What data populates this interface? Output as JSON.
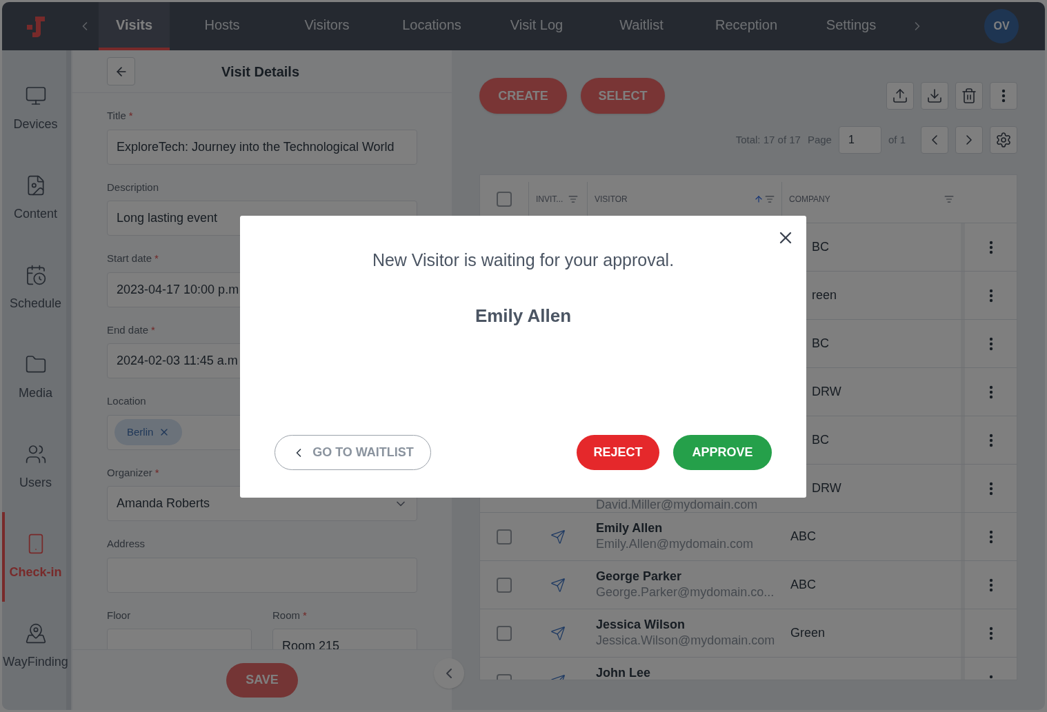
{
  "nav": {
    "items": [
      {
        "label": "Visits",
        "selected": true
      },
      {
        "label": "Hosts",
        "selected": false
      },
      {
        "label": "Visitors",
        "selected": false
      },
      {
        "label": "Locations",
        "selected": false
      },
      {
        "label": "Visit Log",
        "selected": false
      },
      {
        "label": "Waitlist",
        "selected": false
      },
      {
        "label": "Reception",
        "selected": false
      },
      {
        "label": "Settings",
        "selected": false
      }
    ],
    "avatar": "OV"
  },
  "sidebar": {
    "items": [
      {
        "label": "Devices",
        "selected": false,
        "kind": "monitor"
      },
      {
        "label": "Content",
        "selected": false,
        "kind": "content"
      },
      {
        "label": "Schedule",
        "selected": false,
        "kind": "calendar"
      },
      {
        "label": "Media",
        "selected": false,
        "kind": "folder"
      },
      {
        "label": "Users",
        "selected": false,
        "kind": "users"
      },
      {
        "label": "Check-in",
        "selected": true,
        "kind": "checkin"
      },
      {
        "label": "WayFinding",
        "selected": false,
        "kind": "map"
      }
    ]
  },
  "form": {
    "title": "Visit Details",
    "fields": [
      {
        "kind": "text",
        "label": "Title",
        "mark": "*",
        "value": "ExploreTech: Journey into the Technological World"
      },
      {
        "kind": "text",
        "label": "Description",
        "value": "Long lasting event"
      },
      {
        "kind": "text",
        "label": "Start date",
        "mark": "*",
        "value": "2023-04-17 10:00 p.m"
      },
      {
        "kind": "text",
        "label": "End date",
        "mark": "*",
        "value": "2024-02-03 11:45 a.m"
      },
      {
        "kind": "chips",
        "label": "Location",
        "chips": [
          "Berlin"
        ]
      },
      {
        "kind": "select",
        "label": "Organizer",
        "mark": "*",
        "value": "Amanda Roberts"
      },
      {
        "kind": "text",
        "label": "Address"
      }
    ],
    "pair": [
      {
        "label": "Floor"
      },
      {
        "label": "Room",
        "mark": "*",
        "value": "Room 215"
      }
    ],
    "save": "SAVE"
  },
  "list": {
    "create": "CREATE",
    "select": "SELECT",
    "total": "Total: 17 of 17",
    "page_label": "Page",
    "page": "1",
    "page_of": "of 1",
    "header_checked": false,
    "columns": [
      {
        "label": "INVIT...",
        "sorted": false
      },
      {
        "label": "VISITOR",
        "sorted": true
      },
      {
        "label": "COMPANY",
        "sorted": false
      }
    ],
    "rows": [
      {
        "company": "BC"
      },
      {
        "company": "reen"
      },
      {
        "company": "BC"
      },
      {
        "company": "DRW"
      },
      {
        "company": "BC"
      },
      {
        "email": "David.Miller@mydomain.com",
        "company": "DRW"
      },
      {
        "checked": false,
        "name": "Emily Allen",
        "email": "Emily.Allen@mydomain.com",
        "company": "ABC"
      },
      {
        "checked": false,
        "name": "George Parker",
        "email": "George.Parker@mydomain.co...",
        "company": "ABC"
      },
      {
        "checked": false,
        "name": "Jessica Wilson",
        "email": "Jessica.Wilson@mydomain.com",
        "company": "Green"
      },
      {
        "checked": false,
        "name": "John Lee"
      }
    ]
  },
  "dialog": {
    "message": "New Visitor is waiting for your approval.",
    "visitor": "Emily Allen",
    "back": "GO TO WAITLIST",
    "reject": "REJECT",
    "approve": "APPROVE"
  }
}
